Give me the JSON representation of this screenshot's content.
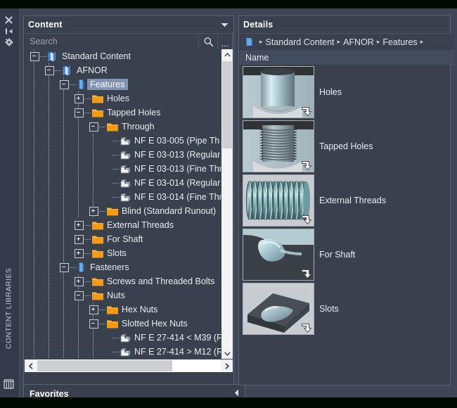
{
  "window": {
    "rail": {
      "vertical_label": "CONTENT LIBRARIES",
      "buttons": [
        {
          "name": "close-icon",
          "label": "Close"
        },
        {
          "name": "auto-hide-icon",
          "label": "Auto-hide"
        },
        {
          "name": "settings-gear-icon",
          "label": "Settings"
        }
      ],
      "bottom_icon": "content-libraries-icon"
    }
  },
  "content_panel": {
    "title": "Content",
    "collapse_icon": "chevron-down-icon",
    "search": {
      "placeholder": "Search",
      "value": "",
      "search_icon": "magnifier-icon",
      "more_label": "..."
    },
    "tree": [
      {
        "label": "Standard Content",
        "depth": 0,
        "state": "minus",
        "icon": "library-icon",
        "selected": false
      },
      {
        "label": "AFNOR",
        "depth": 1,
        "state": "minus",
        "icon": "library-star-icon",
        "selected": false
      },
      {
        "label": "Features",
        "depth": 2,
        "state": "minus",
        "icon": "folder-blue-icon",
        "selected": true
      },
      {
        "label": "Holes",
        "depth": 3,
        "state": "plus",
        "icon": "folder-orange-icon",
        "selected": false
      },
      {
        "label": "Tapped Holes",
        "depth": 3,
        "state": "minus",
        "icon": "folder-orange-icon",
        "selected": false
      },
      {
        "label": "Through",
        "depth": 4,
        "state": "minus",
        "icon": "folder-orange-icon",
        "selected": false
      },
      {
        "label": "NF E 03-005  (Pipe Th",
        "depth": 5,
        "state": "leaf",
        "icon": "part-icon",
        "selected": false
      },
      {
        "label": "NF E 03-013  (Regular",
        "depth": 5,
        "state": "leaf",
        "icon": "part-icon",
        "selected": false
      },
      {
        "label": "NF E 03-013  (Fine Thr",
        "depth": 5,
        "state": "leaf",
        "icon": "part-icon",
        "selected": false
      },
      {
        "label": "NF E 03-014  (Regular",
        "depth": 5,
        "state": "leaf",
        "icon": "part-icon",
        "selected": false
      },
      {
        "label": "NF E 03-014  (Fine Thr",
        "depth": 5,
        "state": "leaf",
        "icon": "part-icon",
        "selected": false
      },
      {
        "label": "Blind (Standard Runout)",
        "depth": 4,
        "state": "plus",
        "icon": "folder-orange-icon",
        "selected": false
      },
      {
        "label": "External Threads",
        "depth": 3,
        "state": "plus",
        "icon": "folder-orange-icon",
        "selected": false
      },
      {
        "label": "For Shaft",
        "depth": 3,
        "state": "plus",
        "icon": "folder-orange-icon",
        "selected": false
      },
      {
        "label": "Slots",
        "depth": 3,
        "state": "plus",
        "icon": "folder-orange-icon",
        "selected": false
      },
      {
        "label": "Fasteners",
        "depth": 2,
        "state": "minus",
        "icon": "folder-blue-icon",
        "selected": false
      },
      {
        "label": "Screws and Threaded Bolts",
        "depth": 3,
        "state": "plus",
        "icon": "folder-orange-icon",
        "selected": false
      },
      {
        "label": "Nuts",
        "depth": 3,
        "state": "minus",
        "icon": "folder-orange-icon",
        "selected": false
      },
      {
        "label": "Hex Nuts",
        "depth": 4,
        "state": "plus",
        "icon": "folder-orange-icon",
        "selected": false
      },
      {
        "label": "Slotted Hex Nuts",
        "depth": 4,
        "state": "minus",
        "icon": "folder-orange-icon",
        "selected": false
      },
      {
        "label": "NF E 27-414 < M39  (R",
        "depth": 5,
        "state": "leaf",
        "icon": "part-icon",
        "selected": false
      },
      {
        "label": "NF E 27-414 > M12  (R",
        "depth": 5,
        "state": "leaf",
        "icon": "part-icon",
        "selected": false
      }
    ],
    "scrollbars": {
      "vertical_up": "scroll-up-icon",
      "vertical_down": "scroll-down-icon",
      "horizontal_left": "scroll-left-icon",
      "horizontal_right": "scroll-right-icon"
    }
  },
  "favorites_bar": {
    "title": "Favorites",
    "expand_icon": "chevron-left-icon"
  },
  "details_panel": {
    "title": "Details",
    "breadcrumb": {
      "root_icon": "folder-blue-icon",
      "items": [
        "Standard Content",
        "AFNOR",
        "Features"
      ],
      "separator": "▸"
    },
    "columns": [
      "Name"
    ],
    "rows": [
      {
        "label": "Holes",
        "thumbnail": "hole-preview",
        "overlay_icon": "drag-arrow-icon"
      },
      {
        "label": "Tapped Holes",
        "thumbnail": "tapped-hole-preview",
        "overlay_icon": "drag-arrow-icon"
      },
      {
        "label": "External Threads",
        "thumbnail": "external-thread-preview",
        "overlay_icon": "drag-arrow-icon"
      },
      {
        "label": "For Shaft",
        "thumbnail": "shaft-feature-preview",
        "overlay_icon": "drag-arrow-icon"
      },
      {
        "label": "Slots",
        "thumbnail": "slot-preview",
        "overlay_icon": "drag-arrow-icon"
      }
    ]
  },
  "colors": {
    "panel_bg": "#39414f",
    "app_bg": "#3f4757",
    "rail_bg": "#333b4a",
    "selection": "#8095b5",
    "folder_orange": "#f59a11",
    "folder_blue": "#5b9bd5",
    "text": "#e9ecf1"
  }
}
